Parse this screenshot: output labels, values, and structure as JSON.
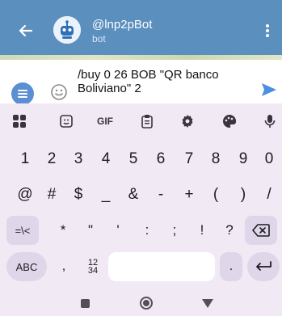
{
  "header": {
    "title": "@lnp2pBot",
    "subtitle": "bot",
    "color": "#5b8fbe",
    "back_icon": "arrow-left-icon",
    "more_icon": "more-vert-icon"
  },
  "composer": {
    "message": "/buy 0 26 BOB \"QR banco Boliviano\" 2",
    "menu_icon": "menu-icon",
    "emoji_icon": "emoji-icon",
    "send_icon": "send-icon",
    "send_color": "#4a90e2"
  },
  "keyboard": {
    "toolbar": {
      "apps_icon": "apps-grid-icon",
      "sticker_icon": "sticker-icon",
      "gif_label": "GIF",
      "clipboard_icon": "clipboard-icon",
      "settings_icon": "gear-icon",
      "theme_icon": "palette-icon",
      "mic_icon": "microphone-icon"
    },
    "number_row": [
      "1",
      "2",
      "3",
      "4",
      "5",
      "6",
      "7",
      "8",
      "9",
      "0"
    ],
    "symbol_row": [
      "@",
      "#",
      "$",
      "_",
      "&",
      "-",
      "+",
      "(",
      ")",
      "/"
    ],
    "third_row": {
      "shift_label": "=\\<",
      "keys": [
        "*",
        "\"",
        "'",
        ":",
        ";",
        "!",
        "?"
      ],
      "backspace_icon": "backspace-icon"
    },
    "bottom_row": {
      "abc_label": "ABC",
      "comma_label": ",",
      "numpad_top": "12",
      "numpad_bottom": "34",
      "period_label": ".",
      "enter_icon": "enter-icon"
    }
  },
  "navbar": {
    "recents_icon": "recents-icon",
    "home_icon": "home-icon",
    "back_icon": "nav-back-icon"
  }
}
